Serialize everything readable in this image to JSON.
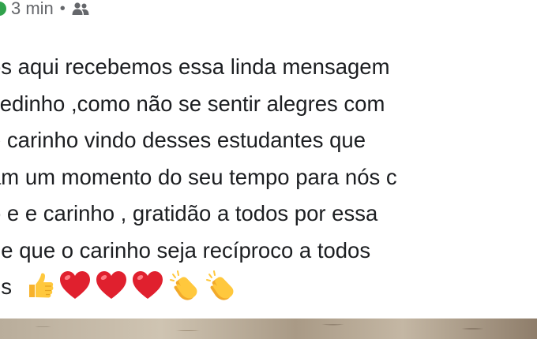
{
  "post": {
    "time": "3 min",
    "separator": "•",
    "audience_icon": "friends-icon",
    "lines": [
      "ós aqui recebemos essa linda mensagem",
      " cedinho ,como não se sentir alegres com",
      "e carinho vindo desses estudantes que",
      "am um momento do seu tempo para nós c",
      "o e e carinho , gratidão a todos por essa",
      "de que o carinho seja recíproco a todos",
      "ês"
    ],
    "emojis": [
      "thumbs-up-icon",
      "red-heart-icon",
      "red-heart-icon",
      "red-heart-icon",
      "clapping-hands-icon",
      "clapping-hands-icon"
    ]
  },
  "colors": {
    "online": "#31a24c",
    "meta_text": "#65676b",
    "body_text": "#1c1e21",
    "heart": "#e0202e",
    "emoji_yellow": "#ffc83d"
  }
}
